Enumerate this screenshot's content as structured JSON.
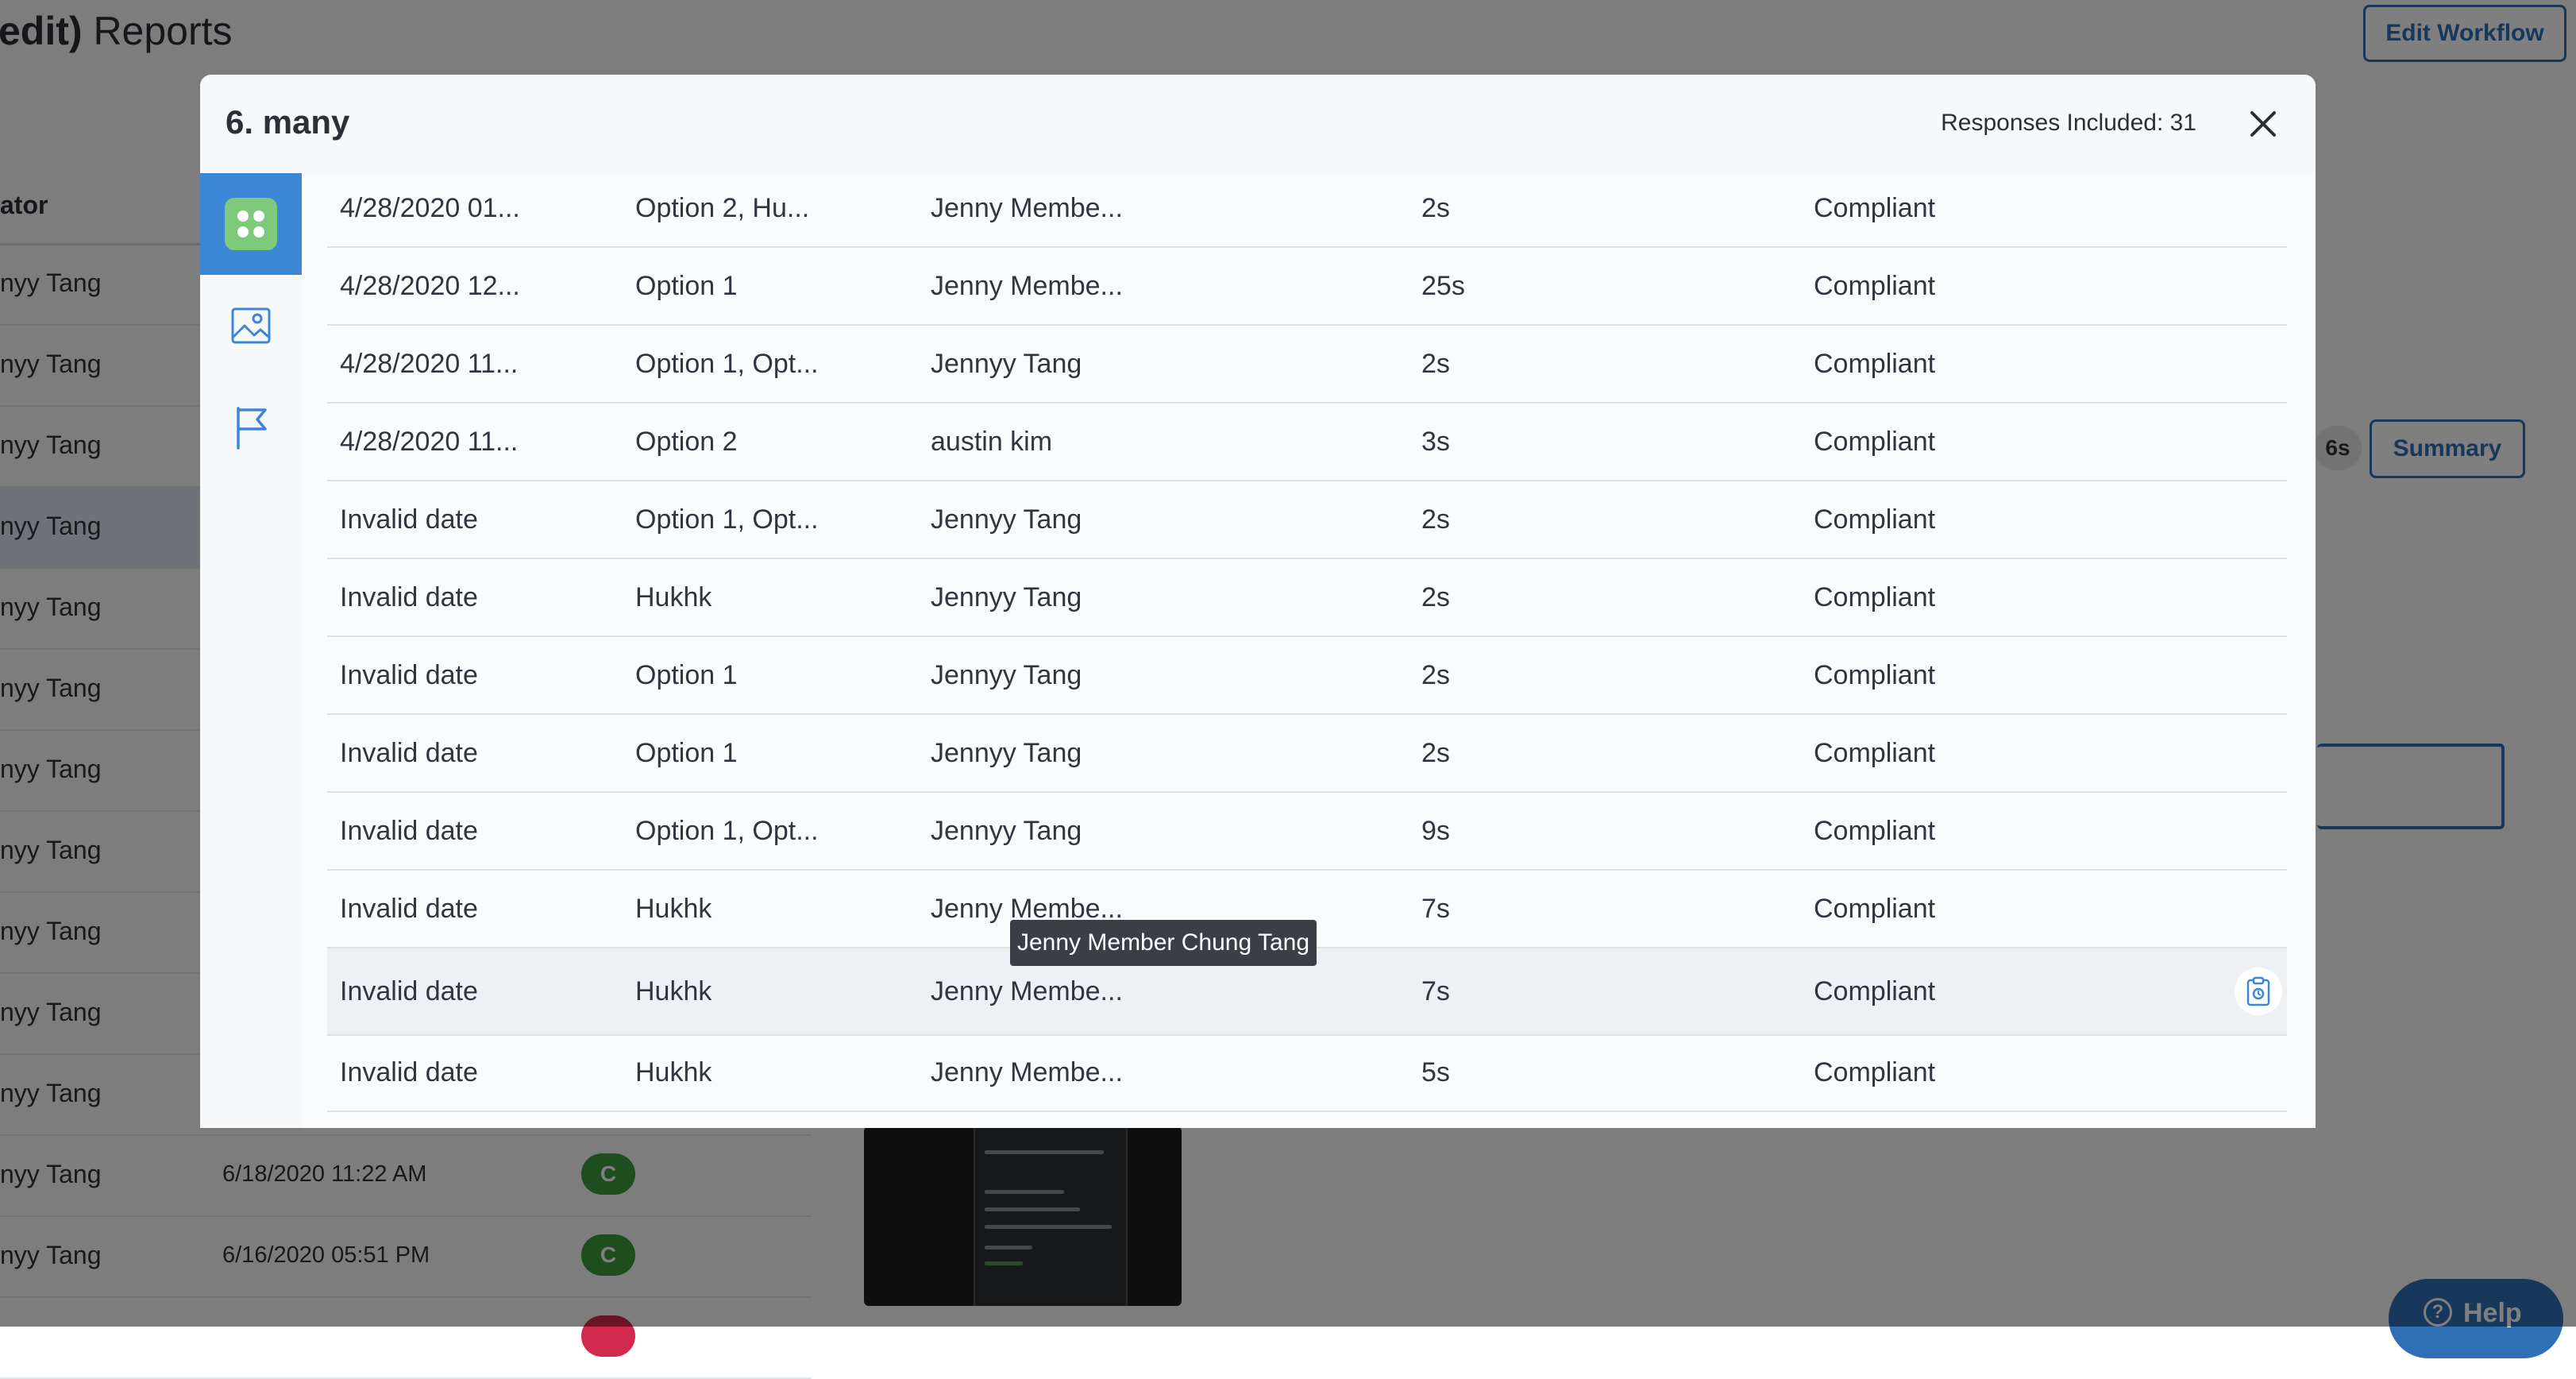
{
  "page": {
    "title_bold": "edit)",
    "title_rest": " Reports",
    "edit_workflow": "Edit Workflow"
  },
  "bg_table": {
    "header": "ator",
    "rows": [
      {
        "name": "nyy Tang",
        "date": "",
        "badge": ""
      },
      {
        "name": "nyy Tang",
        "date": "",
        "badge": ""
      },
      {
        "name": "nyy Tang",
        "date": "",
        "badge": ""
      },
      {
        "name": "nyy Tang",
        "date": "",
        "badge": ""
      },
      {
        "name": "nyy Tang",
        "date": "",
        "badge": ""
      },
      {
        "name": "nyy Tang",
        "date": "",
        "badge": ""
      },
      {
        "name": "nyy Tang",
        "date": "",
        "badge": ""
      },
      {
        "name": "nyy Tang",
        "date": "",
        "badge": ""
      },
      {
        "name": "nyy Tang",
        "date": "",
        "badge": ""
      },
      {
        "name": "nyy Tang",
        "date": "",
        "badge": ""
      },
      {
        "name": "nyy Tang",
        "date": "",
        "badge": ""
      },
      {
        "name": "nyy Tang",
        "date": "6/18/2020 11:22 AM",
        "badge": "C"
      },
      {
        "name": "nyy Tang",
        "date": "6/16/2020 05:51 PM",
        "badge": "C"
      }
    ]
  },
  "right_panel": {
    "time": "6s",
    "summary": "Summary"
  },
  "help": {
    "label": "Help",
    "icon": "question-icon"
  },
  "modal": {
    "title": "6. many",
    "responses_label": "Responses Included: 31",
    "close_icon": "close-icon",
    "sidebar": [
      {
        "icon": "grid-icon",
        "active": true
      },
      {
        "icon": "image-icon",
        "active": false
      },
      {
        "icon": "flag-icon",
        "active": false
      }
    ],
    "rows": [
      {
        "date": "4/28/2020 01...",
        "option": "Option 2, Hu...",
        "name": "Jenny Membe...",
        "duration": "2s",
        "status": "Compliant"
      },
      {
        "date": "4/28/2020 12...",
        "option": "Option 1",
        "name": "Jenny Membe...",
        "duration": "25s",
        "status": "Compliant"
      },
      {
        "date": "4/28/2020 11...",
        "option": "Option 1, Opt...",
        "name": "Jennyy Tang",
        "duration": "2s",
        "status": "Compliant"
      },
      {
        "date": "4/28/2020 11...",
        "option": "Option 2",
        "name": "austin kim",
        "duration": "3s",
        "status": "Compliant"
      },
      {
        "date": "Invalid date",
        "option": "Option 1, Opt...",
        "name": "Jennyy Tang",
        "duration": "2s",
        "status": "Compliant"
      },
      {
        "date": "Invalid date",
        "option": "Hukhk",
        "name": "Jennyy Tang",
        "duration": "2s",
        "status": "Compliant"
      },
      {
        "date": "Invalid date",
        "option": "Option 1",
        "name": "Jennyy Tang",
        "duration": "2s",
        "status": "Compliant"
      },
      {
        "date": "Invalid date",
        "option": "Option 1",
        "name": "Jennyy Tang",
        "duration": "2s",
        "status": "Compliant"
      },
      {
        "date": "Invalid date",
        "option": "Option 1, Opt...",
        "name": "Jennyy Tang",
        "duration": "9s",
        "status": "Compliant"
      },
      {
        "date": "Invalid date",
        "option": "Hukhk",
        "name": "Jenny Membe...",
        "duration": "7s",
        "status": "Compliant"
      },
      {
        "date": "Invalid date",
        "option": "Hukhk",
        "name": "Jenny Membe...",
        "duration": "7s",
        "status": "Compliant"
      },
      {
        "date": "Invalid date",
        "option": "Hukhk",
        "name": "Jenny Membe...",
        "duration": "5s",
        "status": "Compliant"
      }
    ],
    "tooltip": "Jenny Member Chung Tang",
    "row_action_icon": "clipboard-icon"
  },
  "colors": {
    "accent": "#2f6fb6",
    "active_side": "#3b87d6",
    "grid_green": "#7fc97a",
    "badge_green": "#3d9a3d"
  }
}
